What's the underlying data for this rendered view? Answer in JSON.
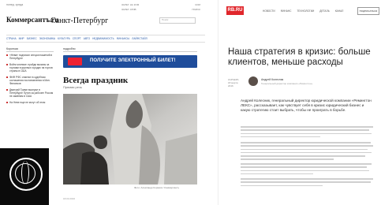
{
  "left": {
    "top_date": "понед. среда",
    "logo": "Коммерсантъ",
    "logo_tld": ".ru",
    "city": "Санкт-Петербург",
    "top_links": [
      "ЗАРЕГ. НА КОМ",
      "КОМ",
      "ЗАРЕГ. АТИВ",
      "ПОИСК"
    ],
    "search_placeholder": "Поиск",
    "nav": [
      "СТРАНА",
      "МИР",
      "БИЗНЕС",
      "ЭКОНОМИКА",
      "КУЛЬТУРА",
      "СПОРТ",
      "АВТО",
      "НЕДВИЖИМОСТЬ",
      "ФИНАНСЫ",
      "ЛАЙФСТАЙЛ"
    ],
    "section_news": "Короткая",
    "section_main": "подробно",
    "news": [
      "«Нева» подписал спецсоглашений в Петербурге",
      "Войти клинике: пройди вызовы за торгами в крупных городах на торгов страны в США",
      "ФИФ РФС отменит в судебном соглашения постановления в Мин. Финансов",
      "Дмитрий Трамп выиграл в Петербурге Путин за рабочее Россия не заменим в США",
      "На Неве еще не могут об этом"
    ],
    "banner_text": "ПОЛУЧИТЕ ЭЛЕКТРОННЫЙ БИЛЕТ!",
    "article_title": "Всегда праздник",
    "article_rubric": "Прямая речь",
    "photo_caption": "Фото: Александр Коряков / Коммерсантъ",
    "article_date": "18.03.2016"
  },
  "right": {
    "logo": "RB.RU",
    "nav": [
      "НОВОСТИ",
      "ФИНАНС",
      "ТЕХНОЛОГИИ",
      "ДЕТАЛЬ",
      "КАНАЛ"
    ],
    "subscribe": "ПОДПИСАТЬСЯ",
    "headline": "Наша стратегия в кризис: больше клиентов, меньше расходы",
    "meta_section": "КАРЬЕРА",
    "meta_date": "18 марта 2016",
    "author": "Андрей Колесник",
    "author_role": "Генеральный директор компании «Ремингтон»",
    "lead": "Андрей Колесник, генеральный директор юридической компании «Ремингтон ЛЕКС», рассказывает, как чувствует себя в кризис юридический бизнес и какую стратегию стоит выбрать, чтобы не проиграть в борьбе."
  }
}
